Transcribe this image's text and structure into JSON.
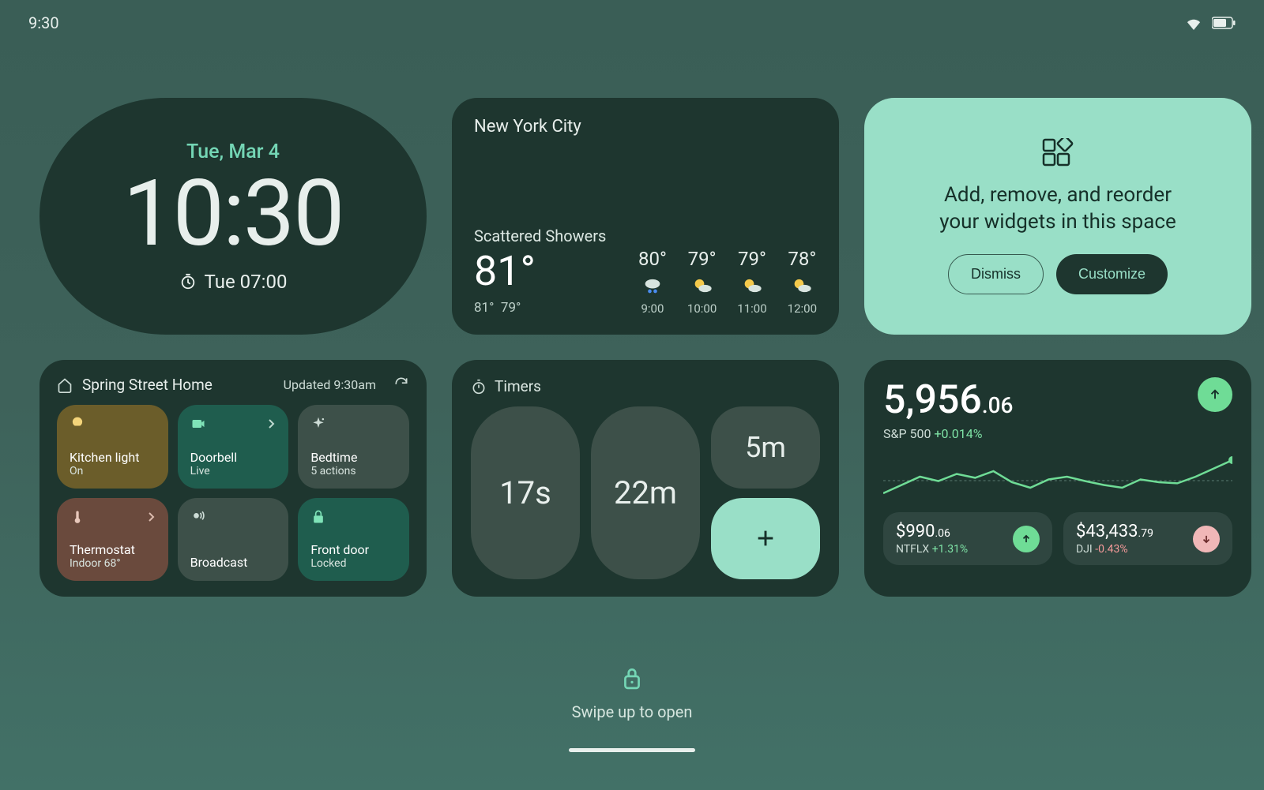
{
  "status": {
    "time": "9:30"
  },
  "clock": {
    "date": "Tue, Mar 4",
    "time": "10:30",
    "alarm": "Tue 07:00"
  },
  "weather": {
    "city": "New York City",
    "condition": "Scattered Showers",
    "temp": "81°",
    "hi": "81°",
    "lo": "79°",
    "forecast": [
      {
        "temp": "80°",
        "time": "9:00",
        "icon": "rain"
      },
      {
        "temp": "79°",
        "time": "10:00",
        "icon": "partly"
      },
      {
        "temp": "79°",
        "time": "11:00",
        "icon": "partly"
      },
      {
        "temp": "78°",
        "time": "12:00",
        "icon": "partly"
      }
    ]
  },
  "customize": {
    "text": "Add, remove, and reorder your widgets in this space",
    "dismiss": "Dismiss",
    "customize": "Customize"
  },
  "home": {
    "title": "Spring Street Home",
    "updated": "Updated 9:30am",
    "tiles": {
      "kitchen": {
        "label": "Kitchen light",
        "sub": "On"
      },
      "doorbell": {
        "label": "Doorbell",
        "sub": "Live"
      },
      "bedtime": {
        "label": "Bedtime",
        "sub": "5 actions"
      },
      "thermo": {
        "label": "Thermostat",
        "sub": "Indoor 68°"
      },
      "broadcast": {
        "label": "Broadcast",
        "sub": ""
      },
      "frontdoor": {
        "label": "Front door",
        "sub": "Locked"
      }
    }
  },
  "timers": {
    "title": "Timers",
    "items": [
      "17s",
      "22m",
      "5m"
    ]
  },
  "stocks": {
    "main": {
      "int": "5,956",
      "dec": ".06",
      "name": "S&P 500",
      "change": "+0.014%"
    },
    "cards": [
      {
        "int": "$990",
        "dec": ".06",
        "name": "NTFLX",
        "change": "+1.31%",
        "dir": "up"
      },
      {
        "int": "$43,433",
        "dec": ".79",
        "name": "DJI",
        "change": "-0.43%",
        "dir": "down"
      }
    ]
  },
  "bottom": {
    "swipe": "Swipe up to open"
  },
  "chart_data": {
    "type": "line",
    "title": "S&P 500 intraday",
    "xlabel": "",
    "ylabel": "",
    "x": [
      0,
      1,
      2,
      3,
      4,
      5,
      6,
      7,
      8,
      9,
      10,
      11,
      12,
      13,
      14,
      15,
      16,
      17,
      18,
      19
    ],
    "values": [
      20,
      35,
      50,
      42,
      55,
      48,
      60,
      40,
      30,
      45,
      50,
      42,
      35,
      30,
      45,
      40,
      38,
      50,
      65,
      80
    ],
    "ylim": [
      0,
      100
    ]
  }
}
